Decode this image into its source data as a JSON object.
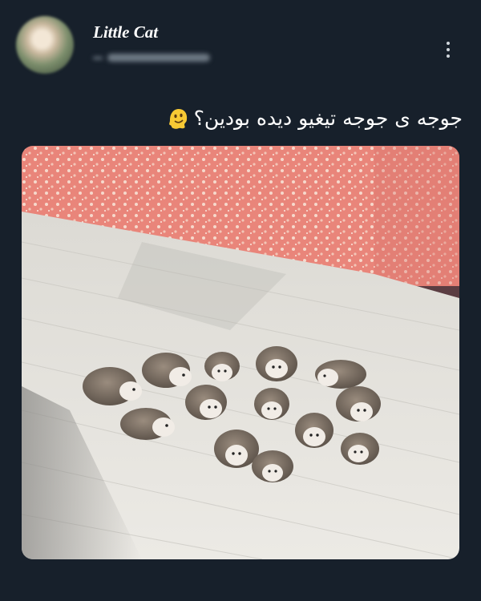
{
  "post": {
    "author": {
      "display_name": "Little Cat",
      "handle": "@_catma_cat"
    },
    "text": "جوجه ی جوجه تیغیو دیده بودین؟",
    "emoji": "melting-face",
    "image": {
      "description_icon": "hedgehog-babies-photo"
    }
  },
  "colors": {
    "background": "#17202b",
    "wallpaper": "#e9857a",
    "floor": "#e8e6e1"
  }
}
